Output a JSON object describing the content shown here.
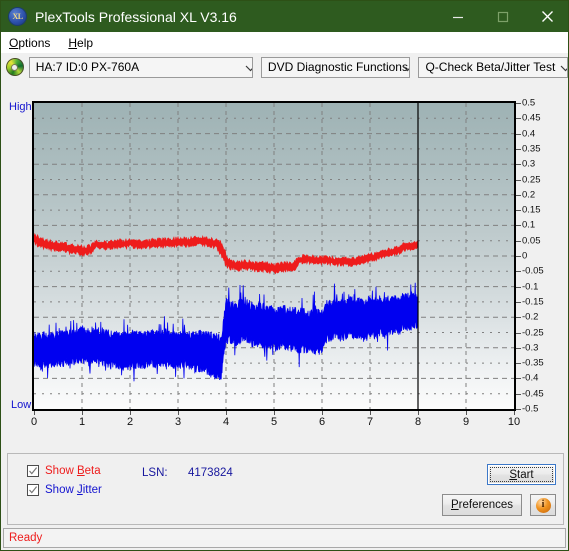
{
  "window": {
    "title": "PlexTools Professional XL V3.16",
    "icon": "xl-logo-icon",
    "icon_text": "XL",
    "minimize_label": "minimize-icon",
    "maximize_label": "maximize-icon",
    "close_label": "close-icon",
    "titlebar_color": "#2e5b1f"
  },
  "menu": {
    "items": [
      {
        "label": "Options",
        "accel": "O"
      },
      {
        "label": "Help",
        "accel": "H"
      }
    ]
  },
  "toolbar": {
    "drive_icon": "optical-disc-icon",
    "drive": "HA:7 ID:0  PX-760A",
    "function": "DVD Diagnostic Functions",
    "test": "Q-Check Beta/Jitter Test"
  },
  "chart_panel": {
    "high_label": "High",
    "low_label": "Low"
  },
  "controls": {
    "show_beta": {
      "label": "Show Beta",
      "accel": "B",
      "checked": true,
      "color": "#ee1c1c"
    },
    "show_jitter": {
      "label": "Show Jitter",
      "accel": "J",
      "checked": true,
      "color": "#1414cf"
    },
    "lsn_label": "LSN:",
    "lsn_value": "4173824",
    "start_label": "Start",
    "start_accel": "S",
    "preferences_label": "Preferences",
    "preferences_accel": "P",
    "info_label": "i",
    "info_icon": "info-icon"
  },
  "status": {
    "text": "Ready",
    "color": "#ee1c1c"
  },
  "chart_data": {
    "type": "line",
    "title": "Q-Check Beta/Jitter Test",
    "xlabel": "",
    "ylabel": "",
    "xlim": [
      0,
      10
    ],
    "ylim": [
      -0.5,
      0.5
    ],
    "xticks": [
      0,
      1,
      2,
      3,
      4,
      5,
      6,
      7,
      8,
      9,
      10
    ],
    "yticks": [
      0.5,
      0.45,
      0.4,
      0.35,
      0.3,
      0.25,
      0.2,
      0.15,
      0.1,
      0.05,
      0,
      -0.05,
      -0.1,
      -0.15,
      -0.2,
      -0.25,
      -0.3,
      -0.35,
      -0.4,
      -0.45,
      -0.5
    ],
    "grid": true,
    "grid_style": "dashed",
    "grid_color": "#808080",
    "legend": [
      "Beta",
      "Jitter"
    ],
    "legend_position": "bottom-left-checkboxes",
    "axis_left_label": "High",
    "axis_bottom_left_label": "Low",
    "data_end_marker_x": 8,
    "series": [
      {
        "name": "Beta",
        "color": "#ee1c1c",
        "type": "band",
        "x": [
          0.0,
          0.1,
          0.2,
          0.3,
          0.4,
          0.5,
          0.6,
          0.7,
          0.8,
          0.9,
          1.0,
          1.1,
          1.2,
          1.3,
          1.4,
          1.5,
          1.6,
          1.7,
          1.8,
          1.9,
          2.0,
          2.1,
          2.2,
          2.3,
          2.4,
          2.5,
          2.6,
          2.7,
          2.8,
          2.9,
          3.0,
          3.1,
          3.2,
          3.3,
          3.4,
          3.5,
          3.6,
          3.7,
          3.8,
          3.9,
          4.0,
          4.1,
          4.2,
          4.3,
          4.4,
          4.5,
          4.6,
          4.7,
          4.8,
          4.9,
          5.0,
          5.1,
          5.2,
          5.3,
          5.4,
          5.5,
          5.6,
          5.7,
          5.8,
          5.9,
          6.0,
          6.1,
          6.2,
          6.3,
          6.4,
          6.5,
          6.6,
          6.7,
          6.8,
          6.9,
          7.0,
          7.1,
          7.2,
          7.3,
          7.4,
          7.5,
          7.6,
          7.7,
          7.8,
          7.9,
          8.0
        ],
        "upper": [
          0.072,
          0.058,
          0.052,
          0.048,
          0.046,
          0.044,
          0.042,
          0.038,
          0.034,
          0.033,
          0.03,
          0.03,
          0.034,
          0.048,
          0.046,
          0.044,
          0.046,
          0.052,
          0.05,
          0.05,
          0.054,
          0.052,
          0.05,
          0.05,
          0.05,
          0.052,
          0.054,
          0.056,
          0.054,
          0.056,
          0.058,
          0.058,
          0.056,
          0.058,
          0.06,
          0.06,
          0.058,
          0.054,
          0.05,
          0.044,
          0.004,
          -0.018,
          -0.018,
          -0.02,
          -0.016,
          -0.018,
          -0.022,
          -0.024,
          -0.022,
          -0.026,
          -0.028,
          -0.026,
          -0.024,
          -0.024,
          -0.026,
          -0.006,
          0.0,
          0.0,
          -0.002,
          -0.004,
          -0.004,
          -0.004,
          -0.006,
          -0.008,
          -0.008,
          -0.008,
          -0.01,
          -0.008,
          -0.004,
          0.0,
          0.004,
          0.008,
          0.012,
          0.018,
          0.022,
          0.026,
          0.03,
          0.038,
          0.044,
          0.04,
          0.048
        ],
        "lower": [
          0.044,
          0.034,
          0.028,
          0.024,
          0.022,
          0.02,
          0.018,
          0.014,
          0.01,
          0.01,
          0.006,
          0.008,
          0.012,
          0.028,
          0.026,
          0.024,
          0.026,
          0.03,
          0.028,
          0.028,
          0.032,
          0.03,
          0.028,
          0.028,
          0.028,
          0.03,
          0.032,
          0.034,
          0.032,
          0.034,
          0.036,
          0.036,
          0.034,
          0.036,
          0.038,
          0.038,
          0.036,
          0.032,
          0.028,
          0.008,
          -0.03,
          -0.042,
          -0.042,
          -0.044,
          -0.04,
          -0.042,
          -0.046,
          -0.048,
          -0.046,
          -0.05,
          -0.052,
          -0.05,
          -0.048,
          -0.048,
          -0.05,
          -0.026,
          -0.02,
          -0.02,
          -0.022,
          -0.024,
          -0.024,
          -0.024,
          -0.026,
          -0.028,
          -0.028,
          -0.028,
          -0.03,
          -0.028,
          -0.024,
          -0.02,
          -0.016,
          -0.012,
          -0.008,
          -0.002,
          0.002,
          0.006,
          0.01,
          0.018,
          0.024,
          0.02,
          0.03
        ],
        "note": "Beta value band; steps down sharply at x=4, recovers near x=5.5, rises toward x=8"
      },
      {
        "name": "Jitter",
        "color": "#0000f0",
        "type": "band",
        "x": [
          0.0,
          0.1,
          0.2,
          0.3,
          0.4,
          0.5,
          0.6,
          0.7,
          0.8,
          0.9,
          1.0,
          1.1,
          1.2,
          1.3,
          1.4,
          1.5,
          1.6,
          1.7,
          1.8,
          1.9,
          2.0,
          2.1,
          2.2,
          2.3,
          2.4,
          2.5,
          2.6,
          2.7,
          2.8,
          2.9,
          3.0,
          3.1,
          3.2,
          3.3,
          3.4,
          3.5,
          3.6,
          3.7,
          3.8,
          3.9,
          4.0,
          4.1,
          4.2,
          4.3,
          4.4,
          4.5,
          4.6,
          4.7,
          4.8,
          4.9,
          5.0,
          5.1,
          5.2,
          5.3,
          5.4,
          5.5,
          5.6,
          5.7,
          5.8,
          5.9,
          6.0,
          6.1,
          6.2,
          6.3,
          6.4,
          6.5,
          6.6,
          6.7,
          6.8,
          6.9,
          7.0,
          7.1,
          7.2,
          7.3,
          7.4,
          7.5,
          7.6,
          7.7,
          7.8,
          7.9,
          8.0
        ],
        "upper": [
          -0.268,
          -0.262,
          -0.258,
          -0.266,
          -0.262,
          -0.258,
          -0.256,
          -0.254,
          -0.25,
          -0.248,
          -0.24,
          -0.246,
          -0.25,
          -0.244,
          -0.252,
          -0.254,
          -0.256,
          -0.258,
          -0.262,
          -0.26,
          -0.264,
          -0.258,
          -0.256,
          -0.262,
          -0.25,
          -0.254,
          -0.256,
          -0.252,
          -0.25,
          -0.256,
          -0.258,
          -0.254,
          -0.256,
          -0.262,
          -0.26,
          -0.258,
          -0.262,
          -0.264,
          -0.268,
          -0.272,
          -0.15,
          -0.16,
          -0.168,
          -0.156,
          -0.15,
          -0.162,
          -0.17,
          -0.166,
          -0.172,
          -0.176,
          -0.18,
          -0.176,
          -0.172,
          -0.178,
          -0.182,
          -0.186,
          -0.184,
          -0.188,
          -0.192,
          -0.19,
          -0.188,
          -0.16,
          -0.156,
          -0.15,
          -0.158,
          -0.152,
          -0.146,
          -0.154,
          -0.15,
          -0.158,
          -0.146,
          -0.152,
          -0.144,
          -0.15,
          -0.142,
          -0.138,
          -0.146,
          -0.13,
          -0.134,
          -0.126,
          -0.13
        ],
        "lower": [
          -0.35,
          -0.356,
          -0.352,
          -0.358,
          -0.352,
          -0.348,
          -0.35,
          -0.346,
          -0.344,
          -0.34,
          -0.336,
          -0.34,
          -0.344,
          -0.338,
          -0.346,
          -0.35,
          -0.352,
          -0.354,
          -0.358,
          -0.356,
          -0.36,
          -0.354,
          -0.352,
          -0.358,
          -0.348,
          -0.352,
          -0.354,
          -0.35,
          -0.348,
          -0.354,
          -0.356,
          -0.352,
          -0.354,
          -0.362,
          -0.364,
          -0.366,
          -0.372,
          -0.378,
          -0.384,
          -0.392,
          -0.27,
          -0.276,
          -0.284,
          -0.27,
          -0.262,
          -0.276,
          -0.286,
          -0.28,
          -0.288,
          -0.292,
          -0.296,
          -0.292,
          -0.288,
          -0.294,
          -0.3,
          -0.304,
          -0.3,
          -0.306,
          -0.31,
          -0.308,
          -0.306,
          -0.27,
          -0.262,
          -0.254,
          -0.266,
          -0.258,
          -0.25,
          -0.262,
          -0.256,
          -0.268,
          -0.25,
          -0.26,
          -0.248,
          -0.256,
          -0.244,
          -0.238,
          -0.25,
          -0.228,
          -0.234,
          -0.224,
          -0.23
        ],
        "note": "Jitter noise band; steps up sharply at x=4 from about -0.31/-0.39 to -0.15/-0.28"
      }
    ]
  }
}
